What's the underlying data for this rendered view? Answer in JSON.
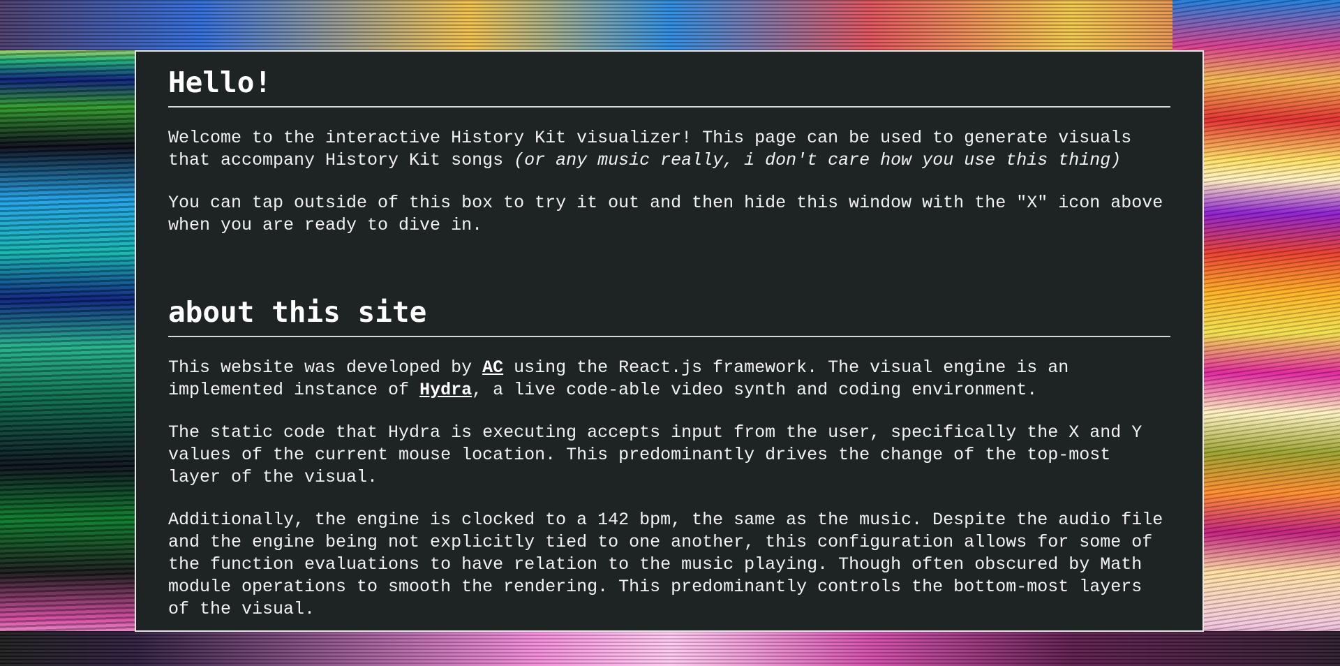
{
  "sections": {
    "hello": {
      "title": "Hello!",
      "p1_text": "Welcome to the interactive History Kit visualizer! This page can be used to generate visuals that accompany History Kit songs ",
      "p1_italic": "(or any music really, i don't care how you use this thing)",
      "p2": "You can tap outside of this box to try it out and then hide this window with the \"X\" icon above when you are ready to dive in."
    },
    "about": {
      "title": "about this site",
      "p1_a": "This website was developed by ",
      "p1_link_ac": "AC",
      "p1_b": " using the React.js framework. The visual engine is an implemented instance of ",
      "p1_link_hydra": "Hydra",
      "p1_c": ", a live code-able video synth and coding environment.",
      "p2": "The static code that Hydra is executing accepts input from the user, specifically the X and Y values of the current mouse location. This predominantly drives the change of the top-most layer of the visual.",
      "p3": "Additionally, the engine is clocked to a 142 bpm, the same as the music. Despite the audio file and the engine being not explicitly tied to one another, this configuration allows for some of the function evaluations to have relation to the music playing. Though often obscured by Math module operations to smooth the rendering. This predominantly controls the bottom-most layers of the visual."
    }
  }
}
